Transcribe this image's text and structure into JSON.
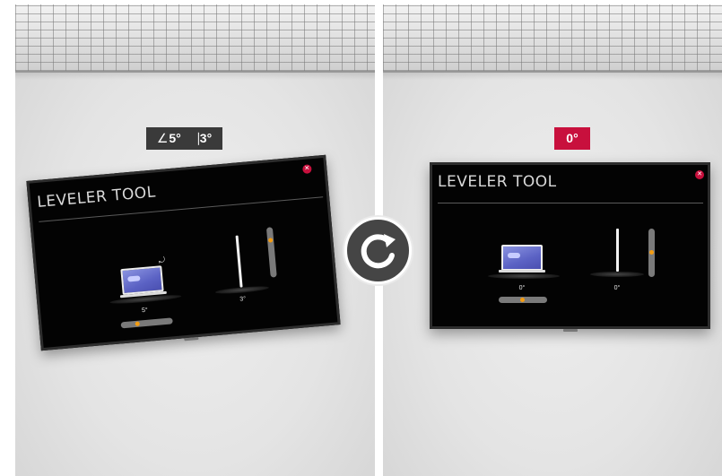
{
  "before": {
    "badge_angle_text": "5°",
    "badge_tilt_text": "3°",
    "tv_title": "LEVELER TOOL",
    "roll_value": "5°",
    "tilt_value": "3°"
  },
  "after": {
    "badge_text": "0°",
    "tv_title": "LEVELER TOOL",
    "roll_value": "0°",
    "tilt_value": "0°"
  },
  "colors": {
    "accent_red": "#c8103d",
    "knob_orange": "#f39c12",
    "tv_black": "#030303"
  },
  "icons": {
    "angle": "angle-icon",
    "tilt": "vertical-tilt-icon",
    "close": "close-icon",
    "rotate": "rotate-clockwise-icon",
    "laptop": "laptop-icon"
  }
}
